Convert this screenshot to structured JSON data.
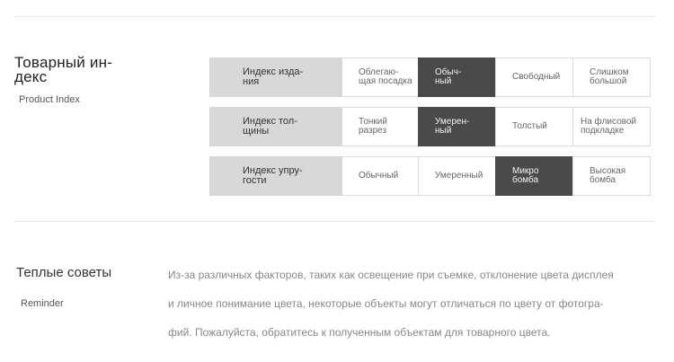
{
  "product_index": {
    "title": "Товарный ин-\nдекс",
    "subtitle": "Product Index",
    "rows": [
      {
        "label": "Индекс изда-\nния",
        "options": [
          "Облегаю-\nщая посадка",
          "Обыч-\nный",
          "Свободный",
          "Слишком\nбольшой"
        ],
        "selected_index": 1
      },
      {
        "label": "Индекс тол-\nщины",
        "options": [
          "Тонкий\nразрез",
          "Умерен-\nный",
          "Толстый",
          "На флисовой\nподкладке"
        ],
        "selected_index": 1
      },
      {
        "label": "Индекс упру-\nгости",
        "options": [
          "Обычный",
          "Умеренный",
          "Микро\nбомба",
          "Высокая\nбомба"
        ],
        "selected_index": 2
      }
    ]
  },
  "reminder": {
    "title": "Теплые советы",
    "subtitle": "Reminder",
    "lines": [
      "Из-за различных факторов, таких как освещение при съемке, отклонение цвета дисплея",
      "и личное понимание цвета, некоторые объекты могут отличаться по цвету от фотогра-",
      "фий. Пожалуйста, обратитесь к полученным объектам для товарного цвета."
    ]
  },
  "colors": {
    "selected": "#4a4a4a",
    "label_bg": "#d8d8d8"
  }
}
